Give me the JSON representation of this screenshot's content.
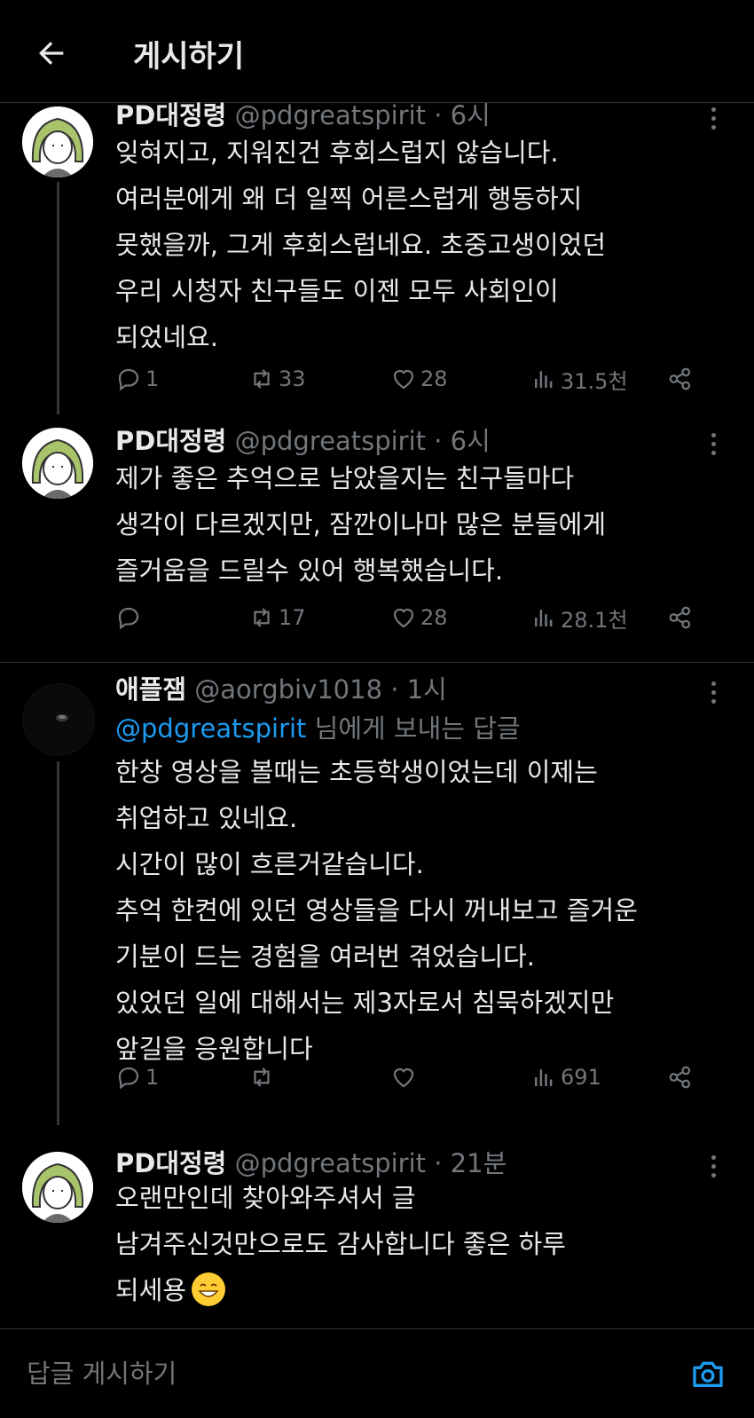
{
  "header": {
    "title": "게시하기"
  },
  "posts": [
    {
      "name": "PD대정령",
      "handle": "@pdgreatspirit · 6시",
      "lines": [
        "잊혀지고, 지워진건 후회스럽지 않습니다.",
        "여러분에게 왜 더 일찍 어른스럽게 행동하지",
        "못했을까, 그게 후회스럽네요. 초중고생이었던",
        "우리 시청자 친구들도 이젠 모두 사회인이",
        "되었네요."
      ],
      "replies": "1",
      "retweets": "33",
      "likes": "28",
      "views": "31.5천"
    },
    {
      "name": "PD대정령",
      "handle": "@pdgreatspirit · 6시",
      "lines": [
        "제가 좋은 추억으로 남았을지는 친구들마다",
        "생각이 다르겠지만, 잠깐이나마 많은 분들에게",
        "즐거움을 드릴수 있어 행복했습니다."
      ],
      "replies": "",
      "retweets": "17",
      "likes": "28",
      "views": "28.1천"
    },
    {
      "name": "애플잼",
      "handle": "@aorgbiv1018 · 1시",
      "reply_to_handle": "@pdgreatspirit",
      "reply_to_suffix": " 님에게 보내는 답글",
      "lines": [
        "한창 영상을 볼때는 초등학생이었는데 이제는",
        "취업하고 있네요.",
        "시간이 많이 흐른거같습니다.",
        "추억 한켠에 있던 영상들을 다시 꺼내보고 즐거운",
        "기분이 드는 경험을 여러번 겪었습니다.",
        "있었던 일에 대해서는 제3자로서 침묵하겠지만",
        "앞길을 응원합니다"
      ],
      "replies": "1",
      "retweets": "",
      "likes": "",
      "views": "691"
    },
    {
      "name": "PD대정령",
      "handle": "@pdgreatspirit · 21분",
      "lines": [
        "오랜만인데 찾아와주셔서 글",
        "남겨주신것만으로도 감사합니다 좋은 하루",
        "되세용"
      ]
    }
  ],
  "compose": {
    "placeholder": "답글 게시하기"
  },
  "colors": {
    "background": "#000000",
    "text": "#e7e9ea",
    "muted": "#71767b",
    "accent": "#1d9bf0"
  },
  "icons": [
    "back-arrow-icon",
    "more-icon",
    "reply-icon",
    "retweet-icon",
    "like-icon",
    "views-icon",
    "share-icon",
    "camera-icon",
    "grinning-emoji-icon"
  ]
}
